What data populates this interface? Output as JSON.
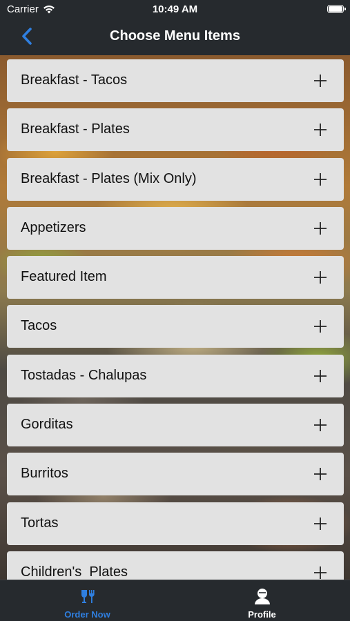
{
  "status_bar": {
    "carrier": "Carrier",
    "time": "10:49 AM"
  },
  "nav": {
    "title": "Choose Menu Items",
    "back_icon": "chevron-left-icon",
    "accent_color": "#2f7fe0"
  },
  "menu_items": [
    {
      "label": "Breakfast - Tacos"
    },
    {
      "label": "Breakfast - Plates"
    },
    {
      "label": "Breakfast - Plates (Mix Only)"
    },
    {
      "label": "Appetizers"
    },
    {
      "label": "Featured Item"
    },
    {
      "label": "Tacos"
    },
    {
      "label": "Tostadas - Chalupas"
    },
    {
      "label": "Gorditas"
    },
    {
      "label": "Burritos"
    },
    {
      "label": "Tortas"
    },
    {
      "label": "Children's  Plates"
    }
  ],
  "tabs": [
    {
      "label": "Order Now",
      "icon": "fork-knife-icon",
      "active": true
    },
    {
      "label": "Profile",
      "icon": "profile-icon",
      "active": false
    }
  ]
}
